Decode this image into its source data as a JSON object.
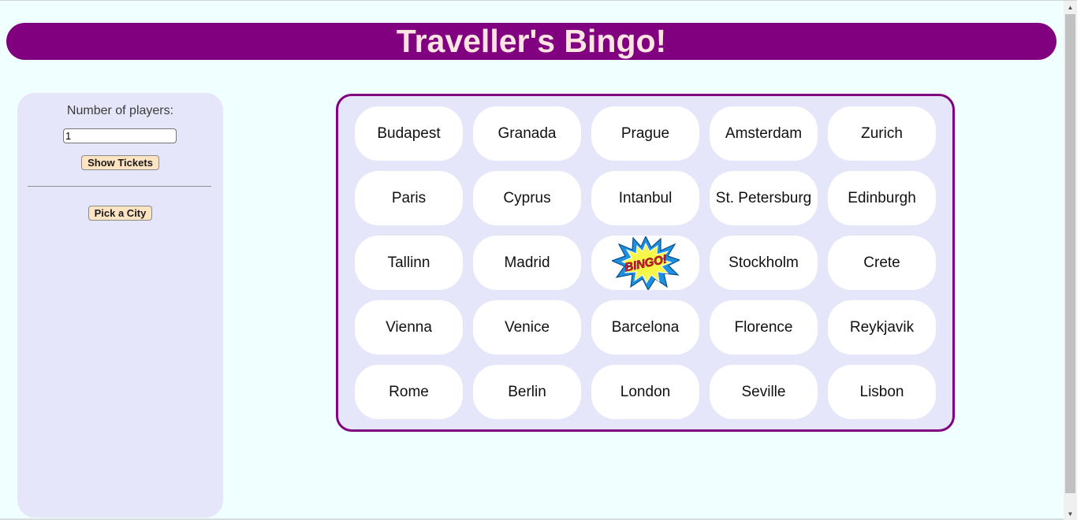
{
  "header": {
    "title": "Traveller's Bingo!"
  },
  "sidebar": {
    "players_label": "Number of players:",
    "players_value": "1",
    "show_tickets_label": "Show Tickets",
    "pick_city_label": "Pick a City"
  },
  "board": {
    "cells": [
      "Budapest",
      "Granada",
      "Prague",
      "Amsterdam",
      "Zurich",
      "Paris",
      "Cyprus",
      "Intanbul",
      "St. Petersburg",
      "Edinburgh",
      "Tallinn",
      "Madrid",
      "",
      "Stockholm",
      "Crete",
      "Vienna",
      "Venice",
      "Barcelona",
      "Florence",
      "Reykjavik",
      "Rome",
      "Berlin",
      "London",
      "Seville",
      "Lisbon"
    ],
    "bingo_image": {
      "text": "BINGO!",
      "icon": "bingo-burst-icon"
    }
  },
  "colors": {
    "background": "#f0ffff",
    "header_bg": "#800080",
    "header_text": "#ffe4e1",
    "panel_bg": "#e6e6fa",
    "button_bg": "#ffe4c4",
    "cell_bg": "#ffffff"
  }
}
